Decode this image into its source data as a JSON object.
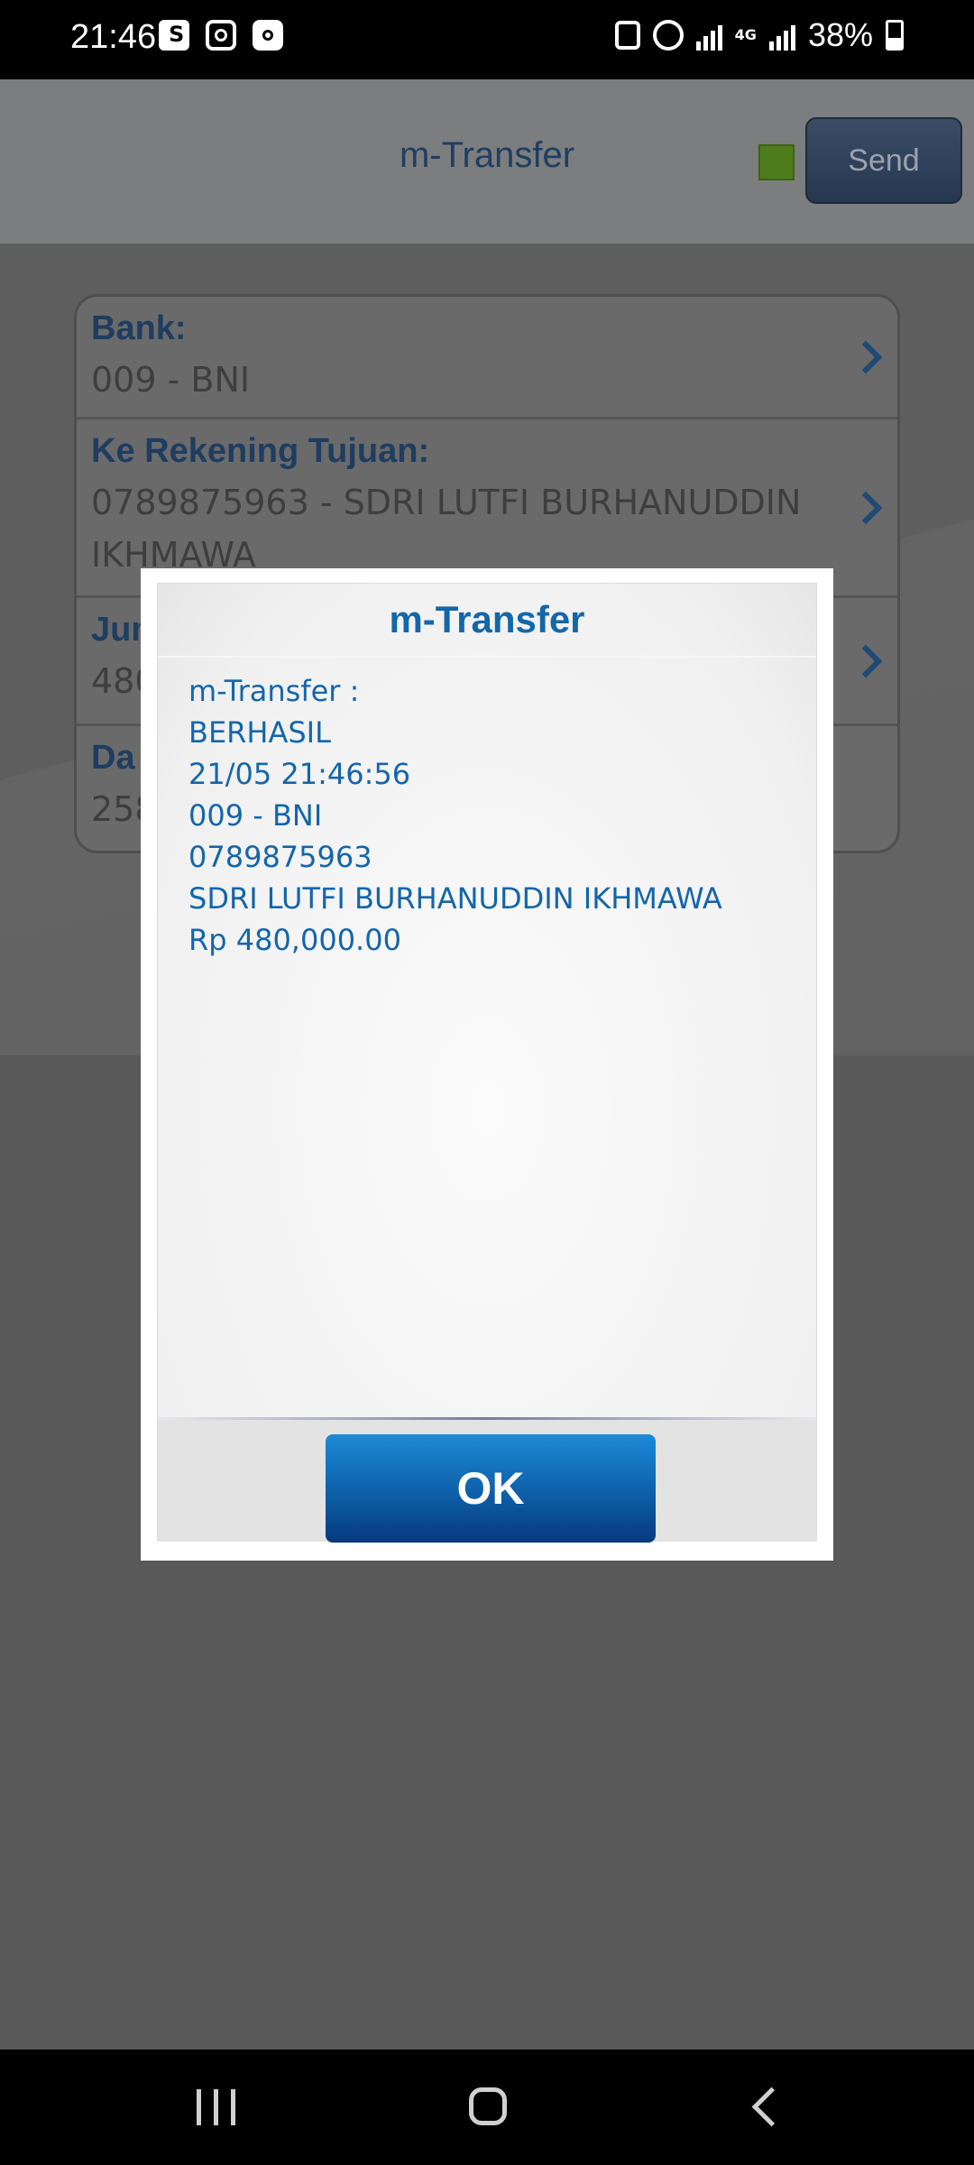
{
  "status_bar": {
    "time": "21:46",
    "network": "4G",
    "battery": "38%",
    "icons": [
      "shopee-bag-icon",
      "instagram-icon",
      "clock-app-icon",
      "lock-icon",
      "alarm-icon",
      "signal-icon",
      "signal-icon",
      "battery-icon"
    ]
  },
  "header": {
    "title": "m-Transfer",
    "send_label": "Send",
    "indicator_color": "#4f7c1b"
  },
  "form": {
    "rows": [
      {
        "label": "Bank:",
        "value": "009 - BNI"
      },
      {
        "label": "Ke Rekening Tujuan:",
        "value": "0789875963 - SDRI LUTFI BURHANUDDIN IKHMAWA"
      },
      {
        "label": "Jum",
        "value": "480"
      },
      {
        "label": "Da",
        "value": "258"
      }
    ]
  },
  "dialog": {
    "title": "m-Transfer",
    "lines": [
      "m-Transfer :",
      "BERHASIL",
      "21/05 21:46:56",
      "009 - BNI",
      "0789875963",
      "SDRI LUTFI BURHANUDDIN IKHMAWA",
      "Rp 480,000.00"
    ],
    "ok_label": "OK",
    "accent_color": "#1466aa"
  },
  "navigation": {
    "recent_icon": "recent-apps-icon",
    "home_icon": "home-icon",
    "back_icon": "back-icon"
  }
}
